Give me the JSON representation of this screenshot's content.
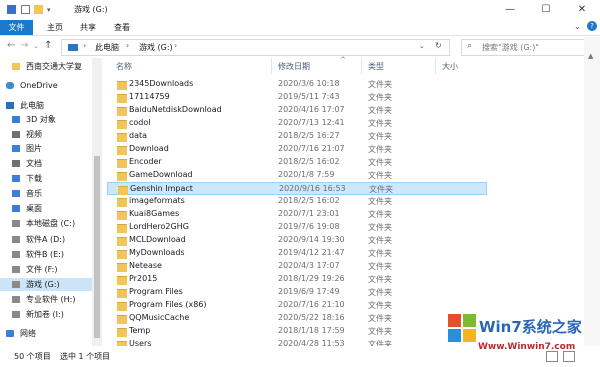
{
  "window": {
    "title": "游戏 (G:)",
    "controls": {
      "minimize": "—",
      "maximize": "☐",
      "close": "✕"
    },
    "qat_caret": "▾"
  },
  "ribbon": {
    "tabs": [
      "文件",
      "主页",
      "共享",
      "查看"
    ],
    "collapse": "⌄",
    "help": "?"
  },
  "nav": {
    "back": "←",
    "forward": "→",
    "recent": "⌄",
    "up": "↑"
  },
  "address": {
    "sep": "›",
    "crumbs": [
      "此电脑",
      "游戏 (G:)"
    ],
    "dropdown": "⌄",
    "refresh": "↻"
  },
  "search": {
    "placeholder": "搜索\"游戏 (G:)\"",
    "icon": "⌕"
  },
  "sidebar": {
    "items": [
      {
        "label": "西南交通大学复",
        "icon": "folder-icon",
        "color": "yellow"
      },
      {
        "label": "OneDrive",
        "icon": "cloud-icon",
        "color": "cloud"
      },
      {
        "label": "此电脑",
        "icon": "computer-icon",
        "color": "pc"
      },
      {
        "label": "3D 对象",
        "icon": "3d-objects-icon",
        "color": "blue"
      },
      {
        "label": "视频",
        "icon": "video-icon",
        "color": "gray"
      },
      {
        "label": "图片",
        "icon": "pictures-icon",
        "color": "blue"
      },
      {
        "label": "文档",
        "icon": "documents-icon",
        "color": "gray"
      },
      {
        "label": "下载",
        "icon": "download-icon",
        "color": "blue"
      },
      {
        "label": "音乐",
        "icon": "music-icon",
        "color": "blue"
      },
      {
        "label": "桌面",
        "icon": "desktop-icon",
        "color": "blue"
      },
      {
        "label": "本地磁盘 (C:)",
        "icon": "drive-icon",
        "color": "drive"
      },
      {
        "label": "软件A (D:)",
        "icon": "drive-icon",
        "color": "drive"
      },
      {
        "label": "软件B (E:)",
        "icon": "drive-icon",
        "color": "drive"
      },
      {
        "label": "文件 (F:)",
        "icon": "drive-icon",
        "color": "drive"
      },
      {
        "label": "游戏 (G:)",
        "icon": "drive-icon",
        "color": "drive",
        "selected": true
      },
      {
        "label": "专业软件 (H:)",
        "icon": "drive-icon",
        "color": "drive"
      },
      {
        "label": "新加卷 (I:)",
        "icon": "drive-icon",
        "color": "drive"
      },
      {
        "label": "网络",
        "icon": "network-icon",
        "color": "net"
      }
    ]
  },
  "columns": {
    "name": "名称",
    "date": "修改日期",
    "type": "类型",
    "size": "大小",
    "sort_indicator": "^"
  },
  "files": [
    {
      "name": "2345Downloads",
      "date": "2020/3/6 10:18",
      "type": "文件夹"
    },
    {
      "name": "17114759",
      "date": "2019/5/11 7:43",
      "type": "文件夹"
    },
    {
      "name": "BaiduNetdiskDownload",
      "date": "2020/4/16 17:07",
      "type": "文件夹"
    },
    {
      "name": "codol",
      "date": "2020/7/13 12:41",
      "type": "文件夹"
    },
    {
      "name": "data",
      "date": "2018/2/5 16:27",
      "type": "文件夹"
    },
    {
      "name": "Download",
      "date": "2020/7/16 21:07",
      "type": "文件夹"
    },
    {
      "name": "Encoder",
      "date": "2018/2/5 16:02",
      "type": "文件夹"
    },
    {
      "name": "GameDownload",
      "date": "2020/1/8 7:59",
      "type": "文件夹"
    },
    {
      "name": "Genshin Impact",
      "date": "2020/9/16 16:53",
      "type": "文件夹",
      "selected": true
    },
    {
      "name": "imageformats",
      "date": "2018/2/5 16:02",
      "type": "文件夹"
    },
    {
      "name": "Kuai8Games",
      "date": "2020/7/1 23:01",
      "type": "文件夹"
    },
    {
      "name": "LordHero2GHG",
      "date": "2019/7/6 19:08",
      "type": "文件夹"
    },
    {
      "name": "MCLDownload",
      "date": "2020/9/14 19:30",
      "type": "文件夹"
    },
    {
      "name": "MyDownloads",
      "date": "2019/4/12 21:47",
      "type": "文件夹"
    },
    {
      "name": "Netease",
      "date": "2020/4/3 17:07",
      "type": "文件夹"
    },
    {
      "name": "Pr2015",
      "date": "2018/1/29 19:26",
      "type": "文件夹"
    },
    {
      "name": "Program Files",
      "date": "2019/6/9 17:49",
      "type": "文件夹"
    },
    {
      "name": "Program Files (x86)",
      "date": "2020/7/16 21:10",
      "type": "文件夹"
    },
    {
      "name": "QQMusicCache",
      "date": "2020/5/22 18:16",
      "type": "文件夹"
    },
    {
      "name": "Temp",
      "date": "2018/1/18 17:59",
      "type": "文件夹"
    },
    {
      "name": "Users",
      "date": "2020/4/28 11:53",
      "type": "文件夹"
    }
  ],
  "status": {
    "count": "50 个项目",
    "selected": "选中 1 个项目"
  },
  "watermark": {
    "title": "Win7系统之家",
    "url": "Www.Winwin7.com"
  }
}
